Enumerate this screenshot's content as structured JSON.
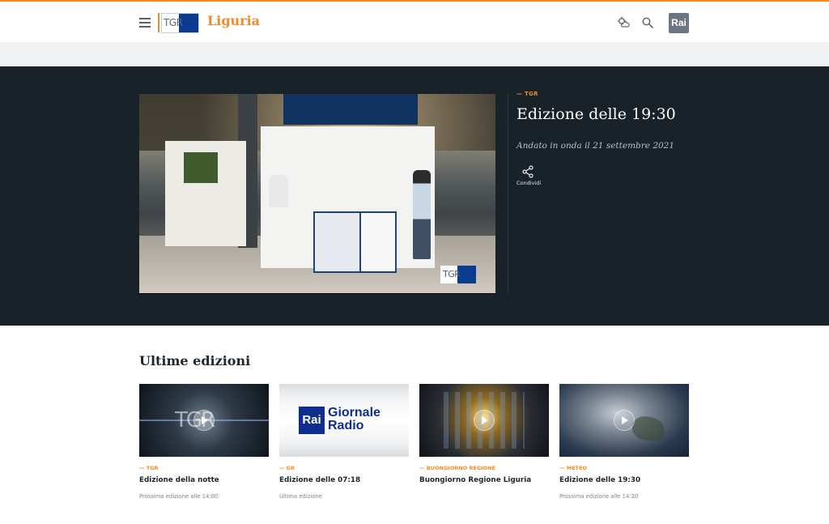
{
  "header": {
    "logo_text": "TGR",
    "region": "Liguria",
    "rai_logo_text": "Rai",
    "icons": [
      "menu-icon",
      "weather-icon",
      "search-icon"
    ],
    "accent_color": "#f28c28"
  },
  "player": {
    "kicker": "TGR",
    "title": "Edizione delle 19:30",
    "aired": "Andato in onda il 21 settembre 2021",
    "share_label": "Condividi",
    "video_overlay_text": "TGR",
    "background_color": "#182228"
  },
  "latest": {
    "heading": "Ultime edizioni",
    "cards": [
      {
        "kicker": "TGR",
        "title": "Edizione della notte",
        "meta": "Prossima edizione alle 14:00"
      },
      {
        "kicker": "GR",
        "title": "Edizione delle 07:18",
        "meta": "Ultima edizione",
        "thumb_rai": "Rai",
        "thumb_text_1": "Giornale",
        "thumb_text_2": "Radio"
      },
      {
        "kicker": "BUONGIORNO REGIONE",
        "title": "Buongiorno Regione Liguria",
        "meta": ""
      },
      {
        "kicker": "METEO",
        "title": "Edizione delle 19:30",
        "meta": "Prossima edizione alle 14:20"
      }
    ]
  }
}
